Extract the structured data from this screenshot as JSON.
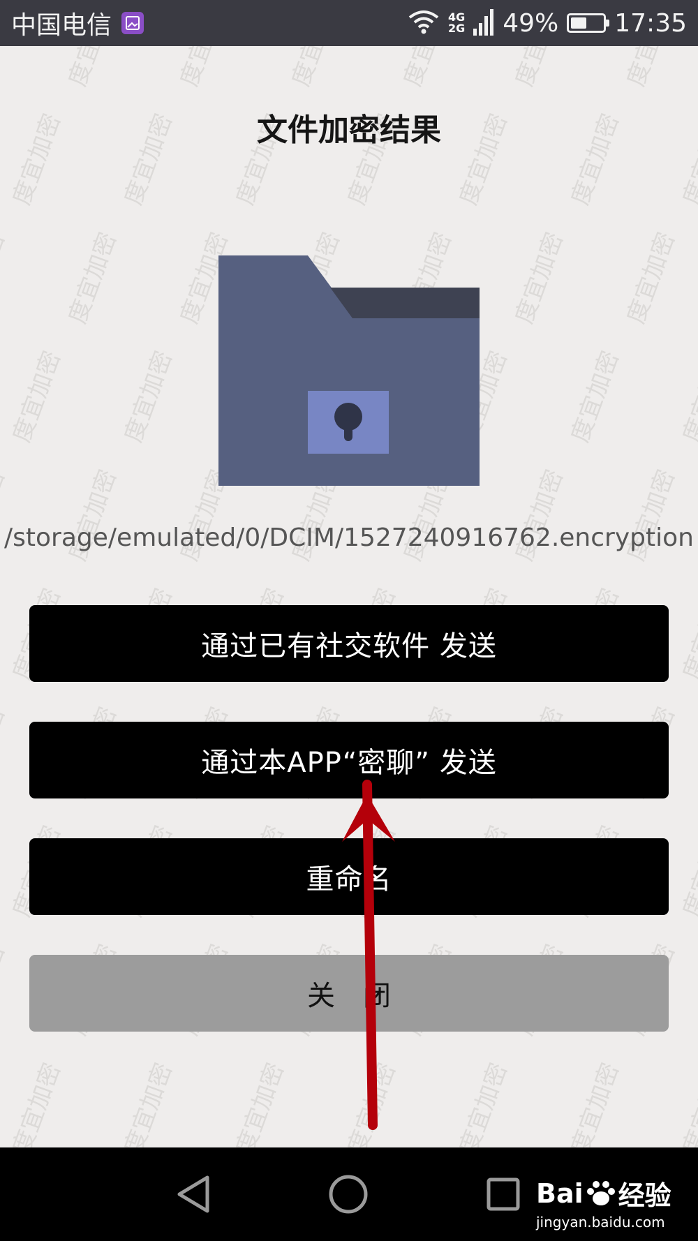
{
  "status_bar": {
    "carrier": "中国电信",
    "network_top": "4G",
    "network_bottom": "2G",
    "battery_percent": "49%",
    "battery_level": 0.49,
    "time": "17:35"
  },
  "page": {
    "title": "文件加密结果",
    "file_path": "/storage/emulated/0/DCIM/1527240916762.encryption",
    "watermark": "度宜加密"
  },
  "buttons": {
    "share_social": "通过已有社交软件  发送",
    "share_app": "通过本APP“密聊”  发送",
    "rename": "重命名",
    "close": "关闭"
  },
  "nav_bar": {
    "logo_main_a": "Bai",
    "logo_main_b": "经验",
    "logo_sub": "jingyan.baidu.com"
  },
  "colors": {
    "background": "#efedec",
    "status_bar": "#3a3a42",
    "folder_body": "#566080",
    "folder_tab_shadow": "#3e4252",
    "lock_plate": "#7886c4",
    "button_primary": "#000000",
    "button_close": "#9c9c9c",
    "arrow": "#b4000a"
  }
}
